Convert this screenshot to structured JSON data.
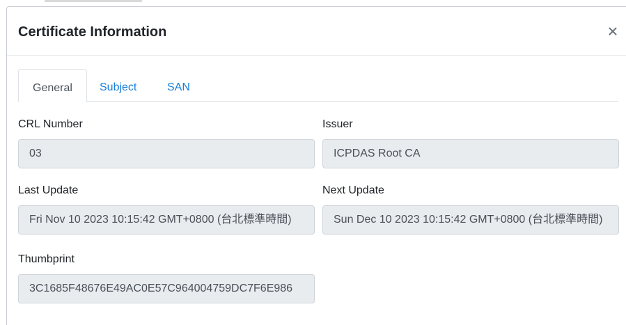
{
  "modal": {
    "title": "Certificate Information",
    "close_icon": "close-icon"
  },
  "tabs": [
    {
      "label": "General",
      "active": true
    },
    {
      "label": "Subject",
      "active": false
    },
    {
      "label": "SAN",
      "active": false
    }
  ],
  "fields": {
    "crl_number": {
      "label": "CRL Number",
      "value": "03"
    },
    "issuer": {
      "label": "Issuer",
      "value": "ICPDAS Root CA"
    },
    "last_update": {
      "label": "Last Update",
      "value": "Fri Nov 10 2023 10:15:42 GMT+0800 (台北標準時間)"
    },
    "next_update": {
      "label": "Next Update",
      "value": "Sun Dec 10 2023 10:15:42 GMT+0800 (台北標準時間)"
    },
    "thumbprint": {
      "label": "Thumbprint",
      "value": "3C1685F48676E49AC0E57C964004759DC7F6E986"
    }
  },
  "colors": {
    "link": "#1a7fd6",
    "input_bg": "#e9ecef",
    "border": "#dee2e6"
  }
}
